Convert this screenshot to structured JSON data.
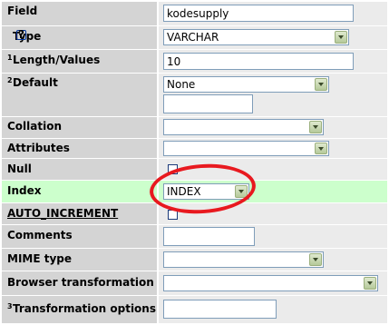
{
  "fields": {
    "field": {
      "label": "Field",
      "value": "kodesupply"
    },
    "type": {
      "label": "Type",
      "help_icon": "help-icon",
      "value": "VARCHAR"
    },
    "length": {
      "label": "Length/Values",
      "sup": "1",
      "value": "10"
    },
    "default": {
      "label": "Default",
      "sup": "2",
      "value": "None",
      "text_value": ""
    },
    "collation": {
      "label": "Collation",
      "value": ""
    },
    "attributes": {
      "label": "Attributes",
      "value": ""
    },
    "null": {
      "label": "Null",
      "checked": false
    },
    "index": {
      "label": "Index",
      "value": "INDEX"
    },
    "auto_increment": {
      "label": "AUTO_INCREMENT",
      "checked": false
    },
    "comments": {
      "label": "Comments",
      "value": ""
    },
    "mime": {
      "label": "MIME type",
      "value": ""
    },
    "browser": {
      "label": "Browser transformation",
      "value": ""
    },
    "transformation": {
      "label": "Transformation options",
      "sup": "3",
      "value": ""
    }
  },
  "colors": {
    "label_bg": "#d4d4d4",
    "value_bg": "#ebebeb",
    "highlight_bg": "#ccffcc",
    "annotation": "#e8191f"
  }
}
